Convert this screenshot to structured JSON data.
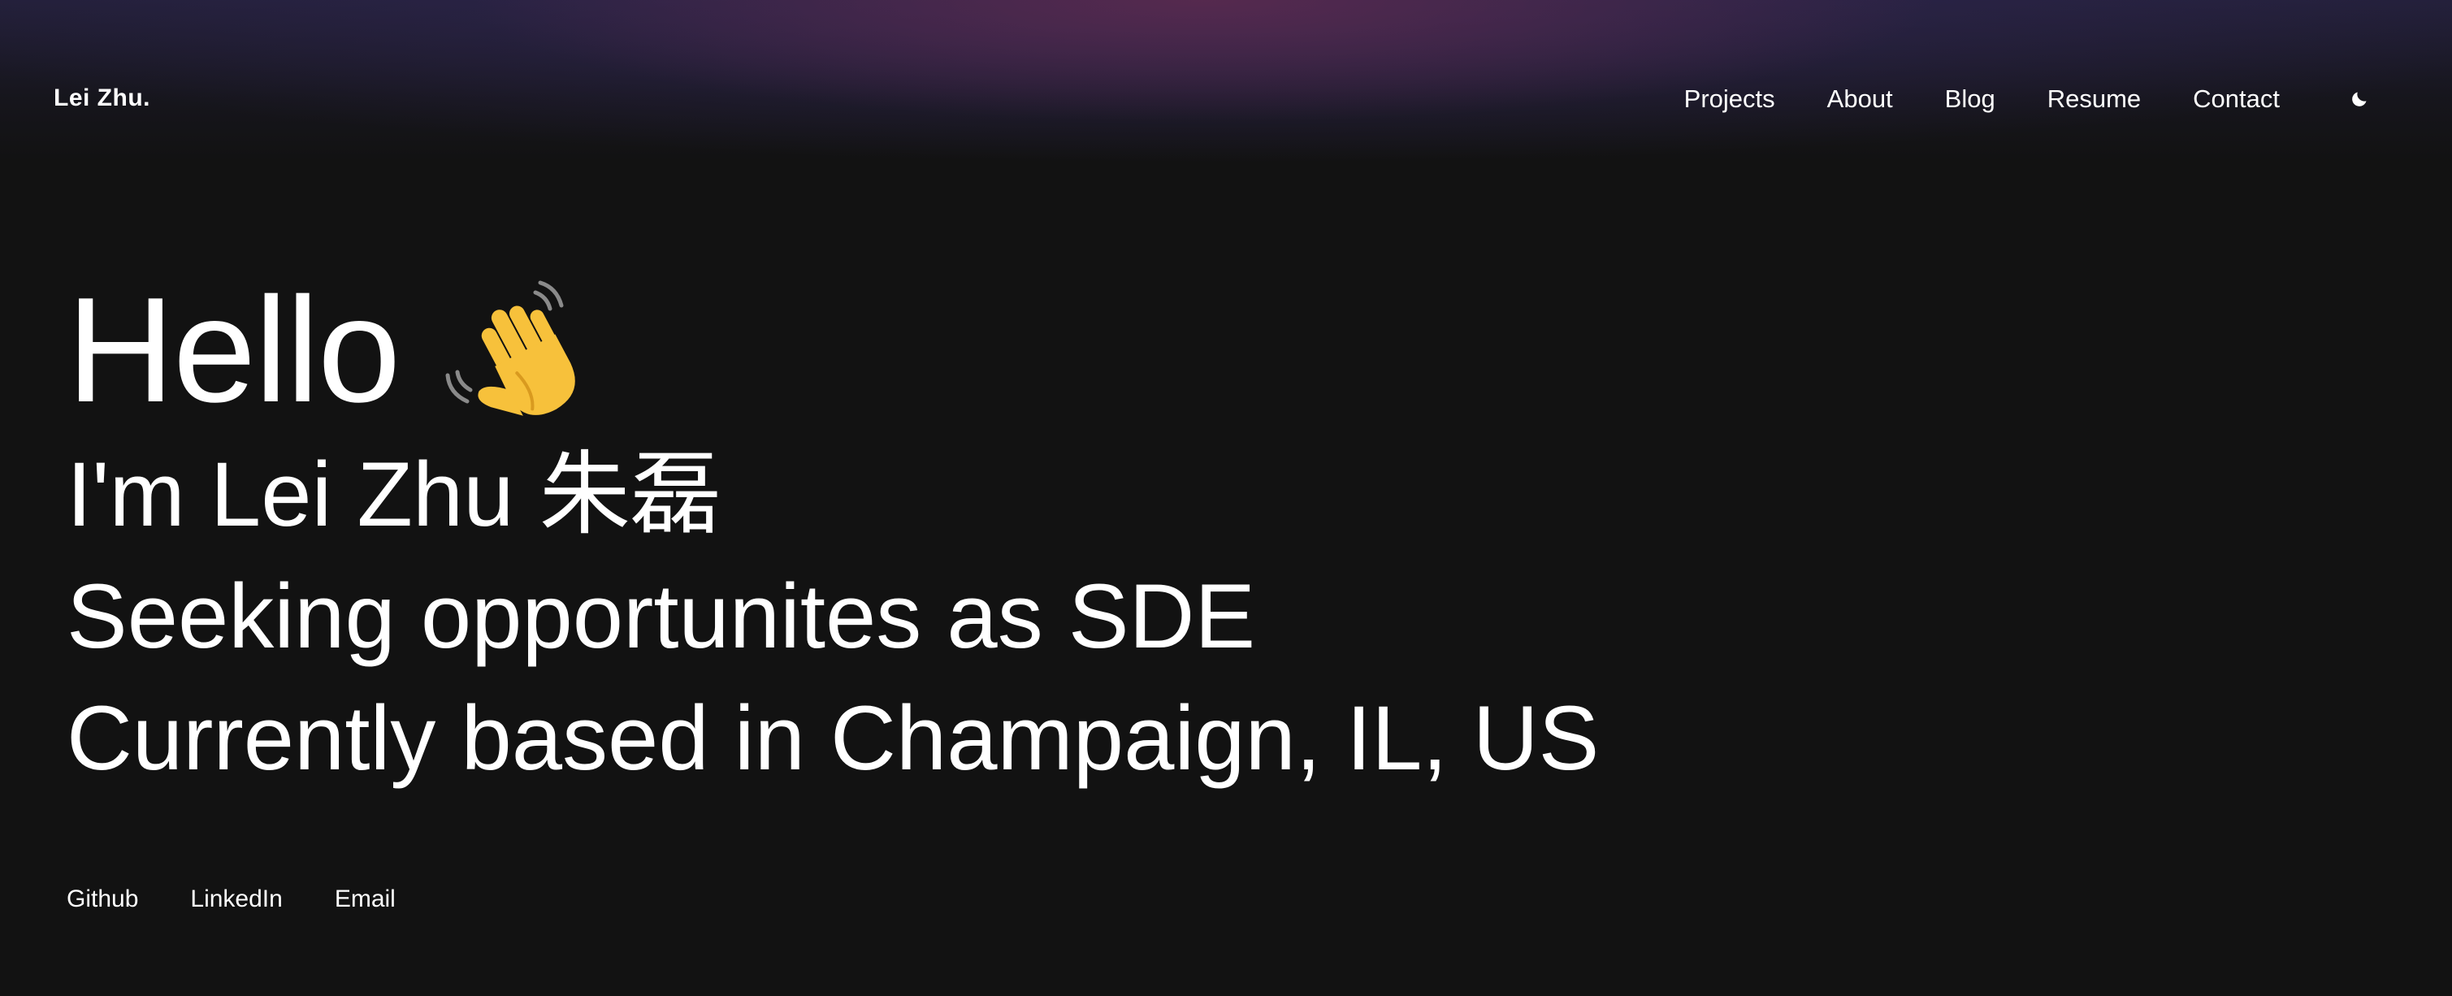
{
  "header": {
    "logo": "Lei Zhu.",
    "nav": {
      "projects": "Projects",
      "about": "About",
      "blog": "Blog",
      "resume": "Resume",
      "contact": "Contact"
    },
    "theme_toggle_icon": "moon-icon"
  },
  "hero": {
    "greeting": "Hello",
    "greeting_icon": "waving-hand-icon",
    "name_line": "I'm Lei Zhu 朱磊",
    "seeking_line": "Seeking opportunites as SDE",
    "location_line": "Currently based in Champaign, IL, US"
  },
  "socials": {
    "github": "Github",
    "linkedin": "LinkedIn",
    "email": "Email"
  },
  "colors": {
    "background": "#121212",
    "text": "#ffffff",
    "glow_purple": "#5c2a4e",
    "glow_indigo": "#302650"
  }
}
